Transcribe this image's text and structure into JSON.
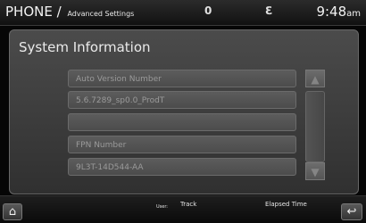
{
  "header": {
    "title": "PHONE /",
    "subtitle": "Advanced Settings",
    "signal_glyph": "0",
    "bluetooth_glyph": "ℇ",
    "time": "9:48",
    "ampm": "am"
  },
  "main": {
    "heading": "System Information",
    "rows": [
      {
        "text": "Auto Version Number"
      },
      {
        "text": "5.6.7289_sp0.0_ProdT"
      },
      {
        "text": ""
      },
      {
        "text": "FPN Number"
      },
      {
        "text": "9L3T-14D544-AA"
      }
    ],
    "scroll": {
      "up_glyph": "▲",
      "down_glyph": "▼"
    }
  },
  "footer": {
    "home_glyph": "⌂",
    "user_label": "User:",
    "track_label": "Track",
    "elapsed_label": "Elapsed Time",
    "back_glyph": "↩"
  },
  "icons": {
    "home": "home-icon",
    "back": "back-arrow-icon",
    "scroll_up": "arrow-up-icon",
    "scroll_down": "arrow-down-icon",
    "bluetooth": "bluetooth-icon",
    "signal": "signal-icon"
  },
  "colors": {
    "background": "#060606",
    "panel": "#3e3e3e",
    "text": "#f2f2f2",
    "row_text": "#9a9a9a"
  }
}
